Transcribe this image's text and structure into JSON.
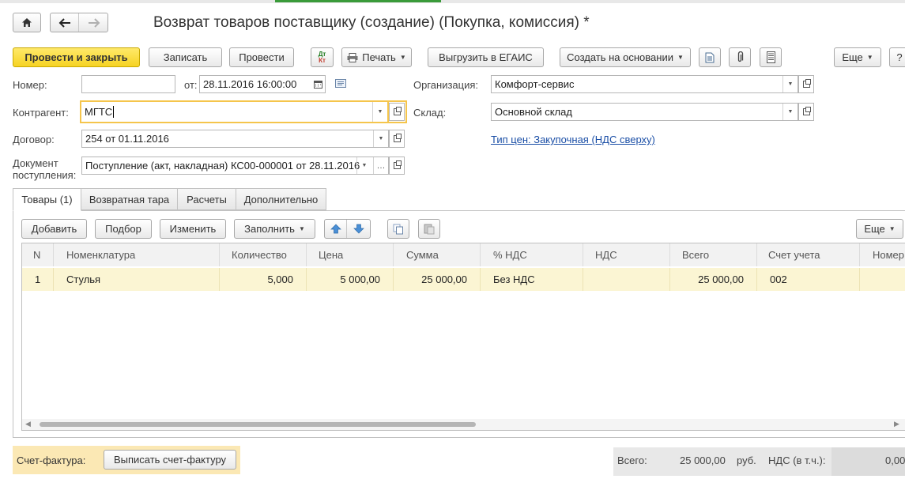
{
  "window": {
    "title": "Возврат товаров поставщику (создание) (Покупка, комиссия) *"
  },
  "toolbar": {
    "post_close": "Провести и закрыть",
    "save": "Записать",
    "post": "Провести",
    "dt_kt_top": "Дт",
    "dt_kt_bottom": "Кт",
    "print": "Печать",
    "egais": "Выгрузить в ЕГАИС",
    "create_based": "Создать на основании",
    "more": "Еще",
    "help": "?"
  },
  "form": {
    "number_label": "Номер:",
    "number_value": "",
    "date_label": "от:",
    "date_value": "28.11.2016 16:00:00",
    "org_label": "Организация:",
    "org_value": "Комфорт-сервис",
    "contractor_label": "Контрагент:",
    "contractor_value": "МГТС",
    "warehouse_label": "Склад:",
    "warehouse_value": "Основной склад",
    "contract_label": "Договор:",
    "contract_value": "254 от 01.11.2016",
    "price_type_link": "Тип цен: Закупочная (НДС сверху)",
    "doc_label_1": "Документ",
    "doc_label_2": "поступления:",
    "doc_value": "Поступление (акт, накладная) КС00-000001 от 28.11.2016"
  },
  "tabs": [
    "Товары (1)",
    "Возвратная тара",
    "Расчеты",
    "Дополнительно"
  ],
  "table_toolbar": {
    "add": "Добавить",
    "select": "Подбор",
    "edit": "Изменить",
    "fill": "Заполнить",
    "more": "Еще"
  },
  "table": {
    "headers": [
      "N",
      "Номенклатура",
      "Количество",
      "Цена",
      "Сумма",
      "% НДС",
      "НДС",
      "Всего",
      "Счет учета",
      "Номер"
    ],
    "rows": [
      [
        "1",
        "Стулья",
        "5,000",
        "5 000,00",
        "25 000,00",
        "Без НДС",
        "",
        "25 000,00",
        "002",
        ""
      ]
    ]
  },
  "footer": {
    "invoice_label": "Счет-фактура:",
    "invoice_button": "Выписать счет-фактуру",
    "total_label": "Всего:",
    "total_value": "25 000,00",
    "currency": "руб.",
    "vat_label": "НДС (в т.ч.):",
    "vat_value": "0,00"
  },
  "colors": {
    "accent_yellow": "#f6d323",
    "focus_border": "#f5c54c",
    "selected_row": "#fbf5d3",
    "link": "#1a4ea6"
  }
}
